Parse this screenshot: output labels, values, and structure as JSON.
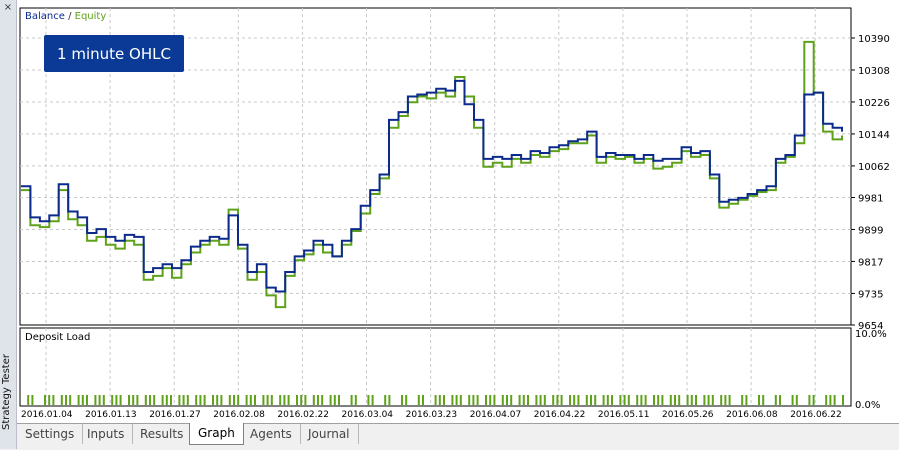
{
  "window": {
    "side_title": "Strategy Tester",
    "close_glyph": "×"
  },
  "main_chart": {
    "legend_balance": "Balance",
    "legend_separator": " / ",
    "legend_equity": "Equity",
    "model_badge": "1 minute OHLC",
    "y_ticks": [
      "10390",
      "10308",
      "10226",
      "10144",
      "10062",
      "9981",
      "9899",
      "9817",
      "9735",
      "9654"
    ]
  },
  "load_chart": {
    "title": "Deposit Load",
    "y_top": "10.0%",
    "y_bottom": "0.0%"
  },
  "x_ticks": [
    "2016.01.04",
    "2016.01.13",
    "2016.01.27",
    "2016.02.08",
    "2016.02.22",
    "2016.03.04",
    "2016.03.23",
    "2016.04.07",
    "2016.04.22",
    "2016.05.11",
    "2016.05.26",
    "2016.06.08",
    "2016.06.22"
  ],
  "tabs": [
    "Settings",
    "Inputs",
    "Results",
    "Graph",
    "Agents",
    "Journal"
  ],
  "active_tab": "Graph",
  "colors": {
    "balance": "#0b2a8c",
    "equity": "#5ea21a",
    "badge_bg": "#0b3a96",
    "grid": "#c8c8c8"
  },
  "chart_data": {
    "type": "line",
    "ylim": [
      9654,
      10390
    ],
    "series": [
      {
        "name": "Balance",
        "values": [
          10010,
          9930,
          9920,
          9935,
          10015,
          9945,
          9930,
          9890,
          9900,
          9880,
          9870,
          9885,
          9880,
          9790,
          9800,
          9810,
          9800,
          9820,
          9855,
          9870,
          9880,
          9875,
          9935,
          9860,
          9790,
          9810,
          9750,
          9740,
          9790,
          9830,
          9845,
          9870,
          9860,
          9830,
          9870,
          9900,
          9960,
          10000,
          10040,
          10180,
          10200,
          10240,
          10245,
          10250,
          10260,
          10255,
          10280,
          10220,
          10180,
          10080,
          10085,
          10080,
          10090,
          10080,
          10100,
          10095,
          10110,
          10115,
          10125,
          10130,
          10150,
          10085,
          10095,
          10090,
          10090,
          10080,
          10090,
          10075,
          10080,
          10080,
          10110,
          10095,
          10100,
          10040,
          9970,
          9975,
          9980,
          9990,
          10000,
          10010,
          10080,
          10090,
          10140,
          10245,
          10250,
          10170,
          10160,
          10150
        ]
      },
      {
        "name": "Equity",
        "values": [
          10000,
          9910,
          9905,
          9920,
          10000,
          9925,
          9910,
          9870,
          9880,
          9860,
          9850,
          9870,
          9860,
          9770,
          9780,
          9800,
          9775,
          9810,
          9840,
          9860,
          9870,
          9860,
          9950,
          9850,
          9770,
          9790,
          9730,
          9700,
          9780,
          9820,
          9835,
          9860,
          9840,
          9830,
          9860,
          9895,
          9940,
          9990,
          10030,
          10160,
          10190,
          10225,
          10240,
          10235,
          10250,
          10240,
          10290,
          10240,
          10160,
          10060,
          10070,
          10060,
          10080,
          10070,
          10090,
          10085,
          10100,
          10105,
          10120,
          10120,
          10140,
          10070,
          10085,
          10080,
          10085,
          10070,
          10080,
          10055,
          10060,
          10070,
          10100,
          10085,
          10090,
          10030,
          9955,
          9965,
          9975,
          9985,
          9995,
          10000,
          10070,
          10085,
          10120,
          10380,
          10250,
          10150,
          10130,
          10140
        ]
      }
    ]
  }
}
